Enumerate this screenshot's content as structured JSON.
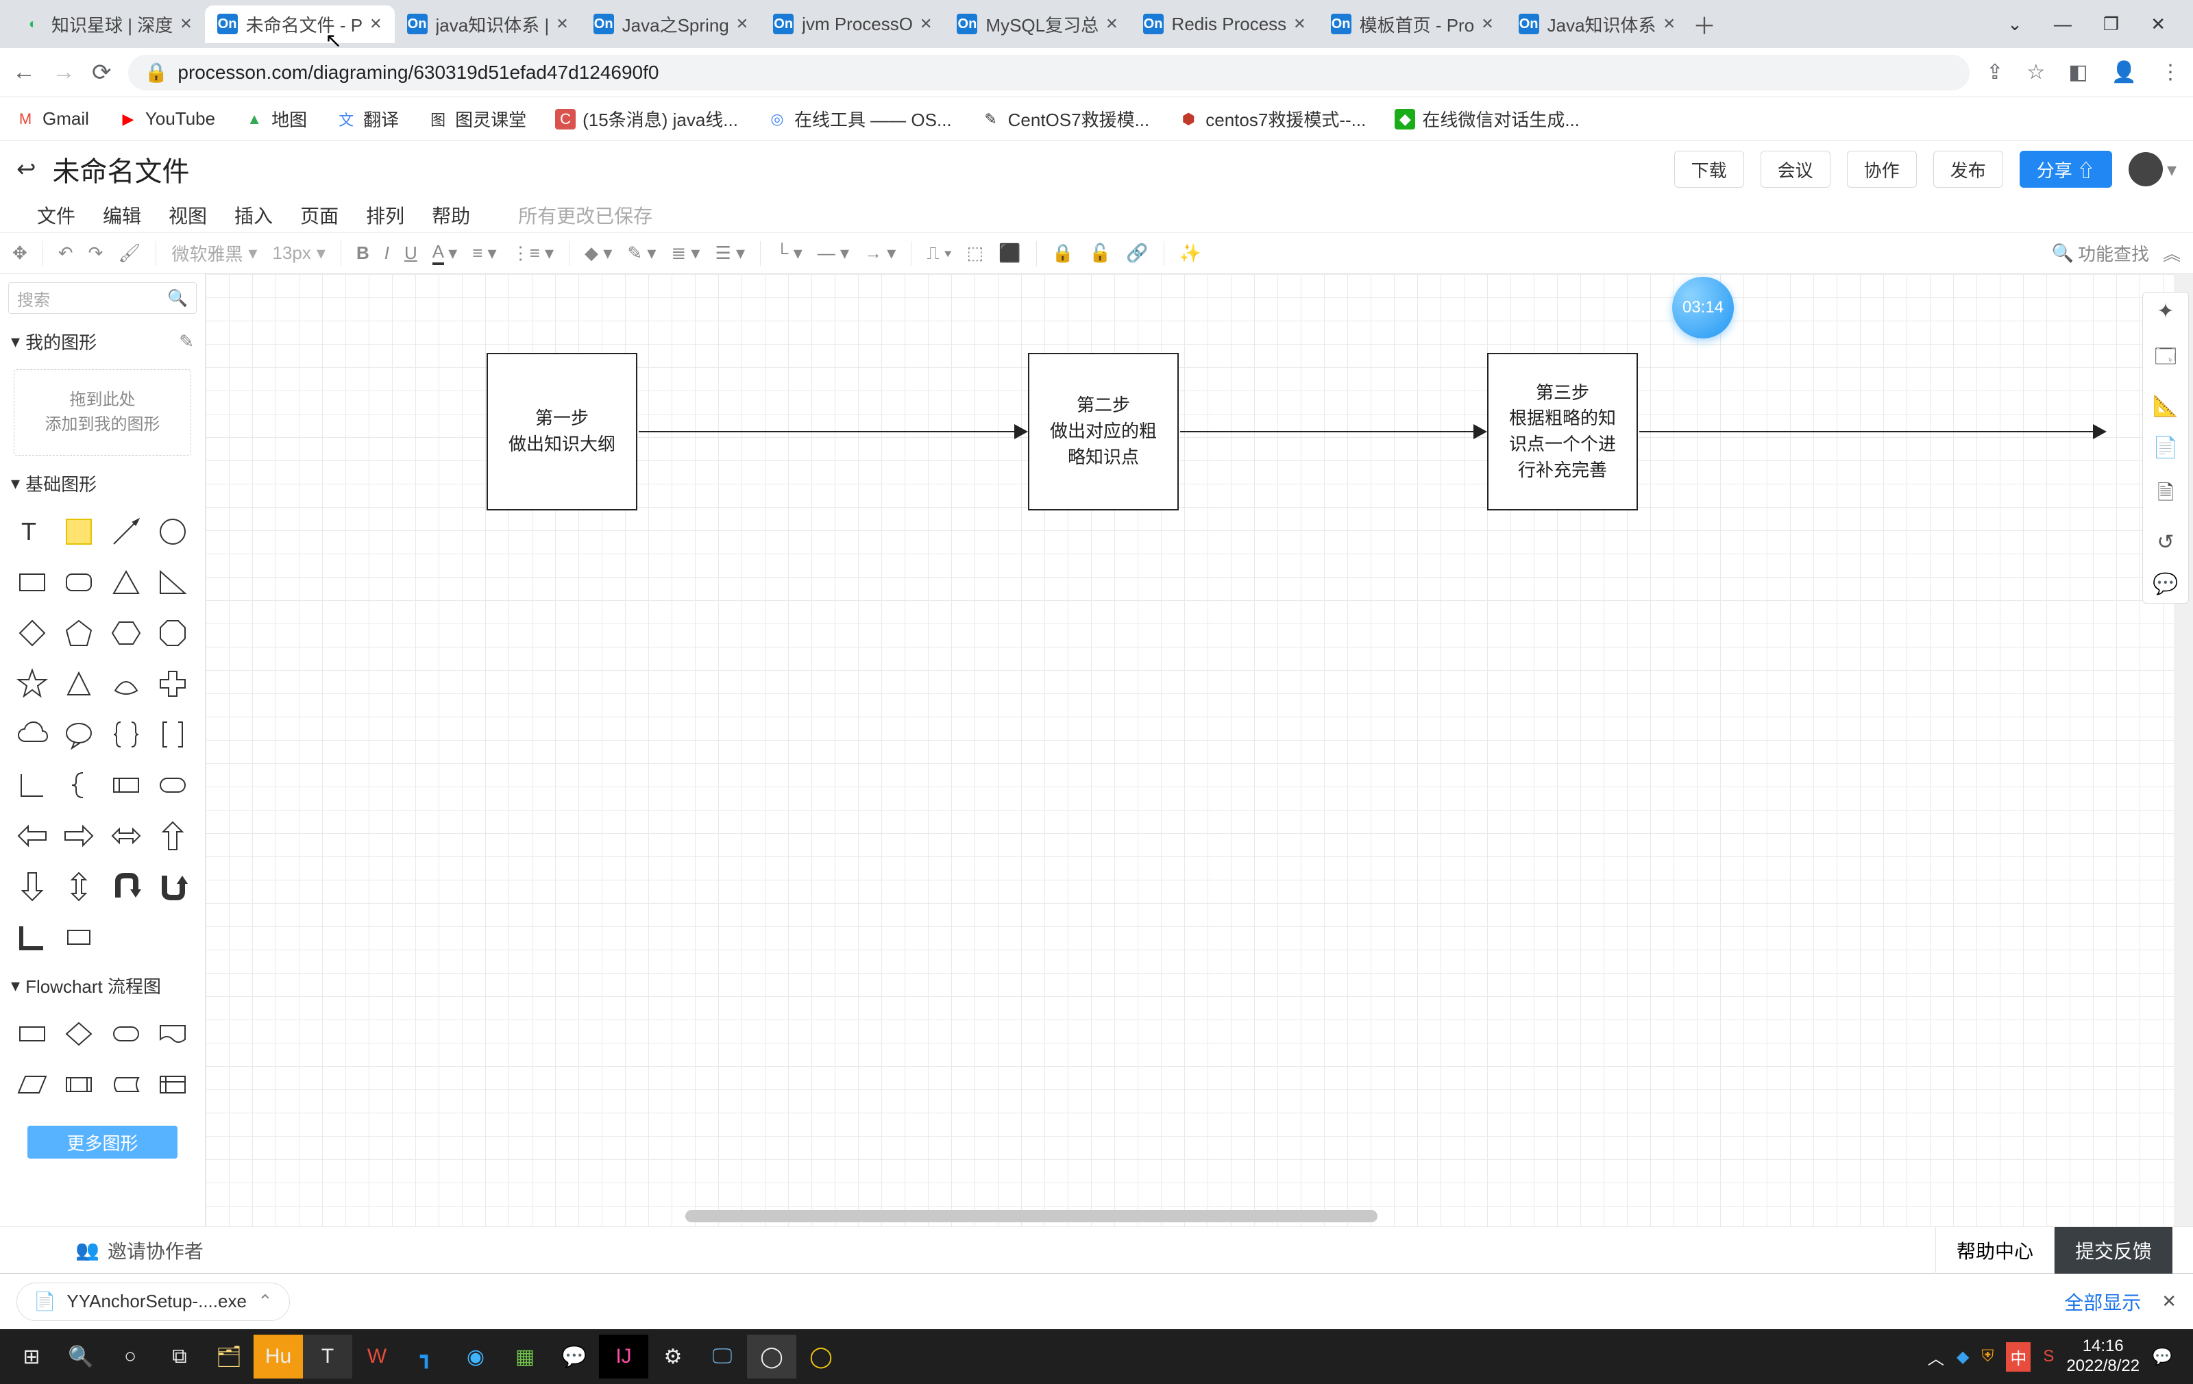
{
  "browser": {
    "tabs": [
      {
        "title": "知识星球 | 深度",
        "fav": "green"
      },
      {
        "title": "未命名文件 - P",
        "fav": "on",
        "active": true
      },
      {
        "title": "java知识体系 |",
        "fav": "on"
      },
      {
        "title": "Java之Spring",
        "fav": "on"
      },
      {
        "title": "jvm ProcessO",
        "fav": "on"
      },
      {
        "title": "MySQL复习总",
        "fav": "on"
      },
      {
        "title": "Redis Process",
        "fav": "on"
      },
      {
        "title": "模板首页 - Pro",
        "fav": "on"
      },
      {
        "title": "Java知识体系",
        "fav": "on"
      }
    ],
    "url": "processon.com/diagraming/630319d51efad47d124690f0",
    "bookmarks": [
      {
        "label": "Gmail",
        "ico": "M",
        "color": "#ea4335"
      },
      {
        "label": "YouTube",
        "ico": "▶",
        "color": "#ff0000"
      },
      {
        "label": "地图",
        "ico": "▲",
        "color": "#34a853"
      },
      {
        "label": "翻译",
        "ico": "文",
        "color": "#4285f4"
      },
      {
        "label": "图灵课堂",
        "ico": "图",
        "color": "#666"
      },
      {
        "label": "(15条消息) java线...",
        "ico": "C",
        "color": "#d9534f"
      },
      {
        "label": "在线工具 —— OS...",
        "ico": "◎",
        "color": "#4285f4"
      },
      {
        "label": "CentOS7救援模...",
        "ico": "✎",
        "color": "#555"
      },
      {
        "label": "centos7救援模式--...",
        "ico": "⬢",
        "color": "#c0392b"
      },
      {
        "label": "在线微信对话生成...",
        "ico": "◆",
        "color": "#1aad19"
      }
    ]
  },
  "app": {
    "doc_title": "未命名文件",
    "header_buttons": {
      "download": "下载",
      "meeting": "会议",
      "collab": "协作",
      "publish": "发布",
      "share": "分享 ⇧"
    },
    "menus": [
      "文件",
      "编辑",
      "视图",
      "插入",
      "页面",
      "排列",
      "帮助"
    ],
    "save_status": "所有更改已保存",
    "toolbar": {
      "font": "微软雅黑",
      "size": "13px",
      "find": "功能查找"
    },
    "left": {
      "search_ph": "搜索",
      "my_shapes": "我的图形",
      "drop_line1": "拖到此处",
      "drop_line2": "添加到我的图形",
      "basic": "基础图形",
      "flowchart": "Flowchart 流程图",
      "more": "更多图形"
    },
    "canvas": {
      "node1": "第一步\n做出知识大纲",
      "node2": "第二步\n做出对应的粗\n略知识点",
      "node3": "第三步\n根据粗略的知\n识点一个个进\n行补充完善",
      "timer": "03:14"
    },
    "footer": {
      "invite": "邀请协作者",
      "help": "帮助中心",
      "feedback": "提交反馈"
    }
  },
  "download": {
    "file": "YYAnchorSetup-....exe",
    "show_all": "全部显示"
  },
  "taskbar": {
    "time": "14:16",
    "date": "2022/8/22"
  }
}
